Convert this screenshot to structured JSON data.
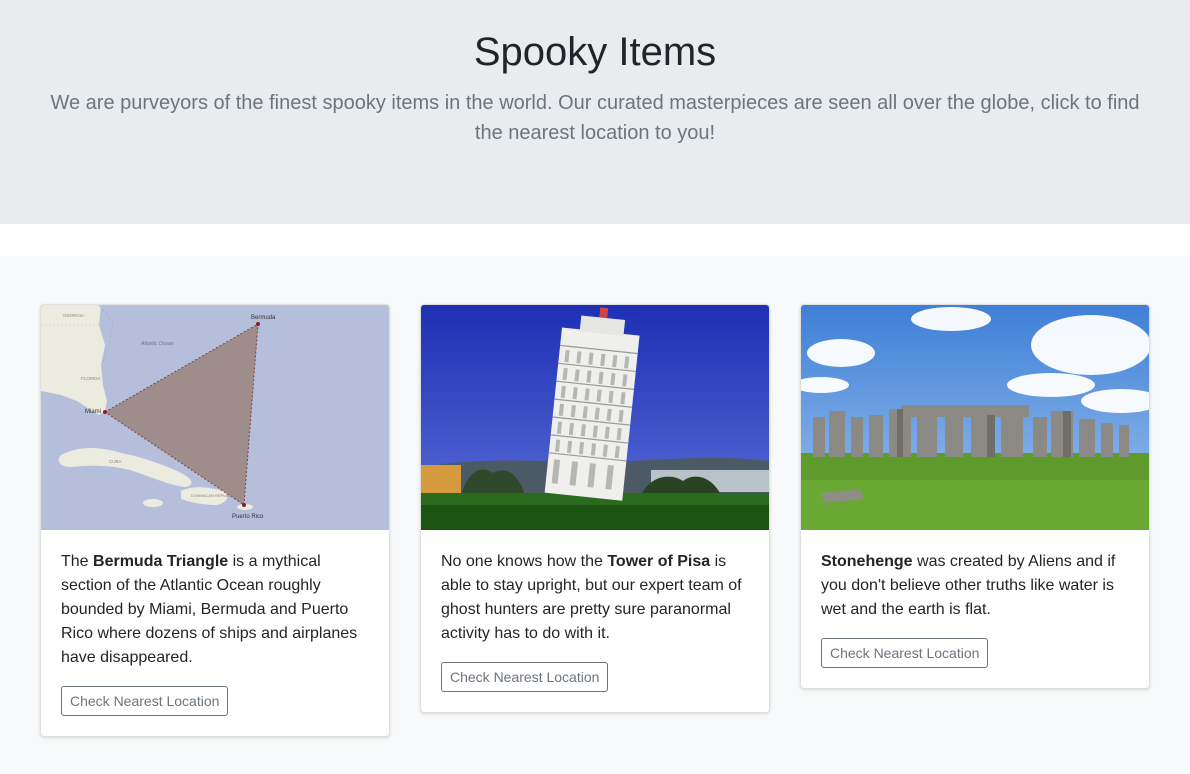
{
  "hero": {
    "title": "Spooky Items",
    "lead": "We are purveyors of the finest spooky items in the world. Our curated masterpieces are seen all over the globe, click to find the nearest location to you!"
  },
  "cards": [
    {
      "image": "bermuda-triangle-map",
      "text_prefix": "The ",
      "bold": "Bermuda Triangle",
      "text_suffix": " is a mythical section of the Atlantic Ocean roughly bounded by Miami, Bermuda and Puerto Rico where dozens of ships and airplanes have disappeared.",
      "button_label": "Check Nearest Location",
      "map_labels": {
        "bermuda": "Bermuda",
        "miami": "Miami",
        "puerto_rico": "Puerto Rico",
        "atlantic": "Atlantic Ocean",
        "florida": "FLORIDA",
        "cuba": "CUBA",
        "georgia": "GEORGIA",
        "dominican": "DOMINICAN REPUBLIC"
      }
    },
    {
      "image": "tower-of-pisa-photo",
      "text_prefix": "No one knows how the ",
      "bold": "Tower of Pisa",
      "text_suffix": " is able to stay upright, but our expert team of ghost hunters are pretty sure paranormal activity has to do with it.",
      "button_label": "Check Nearest Location"
    },
    {
      "image": "stonehenge-photo",
      "text_prefix": "",
      "bold": "Stonehenge",
      "text_suffix": " was created by Aliens and if you don't believe other truths like water is wet and the earth is flat.",
      "button_label": "Check Nearest Location"
    }
  ],
  "colors": {
    "hero_bg": "#e9ecef",
    "album_bg": "#f8f9fa",
    "muted": "#6c757d"
  }
}
